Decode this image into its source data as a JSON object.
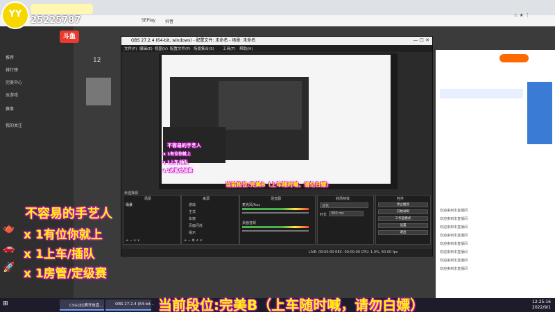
{
  "streamer": {
    "uid": "25225787",
    "avatar_label": "YY"
  },
  "browser": {
    "bookmarks": [
      "SEPlay",
      "抖音"
    ]
  },
  "site": {
    "logo": "斗鱼",
    "sidebar_items": [
      "推荐",
      "排行榜",
      "完美中心",
      "云游戏",
      "赛事",
      "我的关注"
    ],
    "count": "12"
  },
  "obs": {
    "title": "OBS 27.2.4 (64-bit, windows) - 配置文件: 未命名 - 场景: 未命名",
    "menu": [
      "文件(F)",
      "编辑(E)",
      "视图(V)",
      "配置文件(P)",
      "场景集合(S)",
      "工具(T)",
      "帮助(H)"
    ],
    "docks": [
      "场景",
      "来源",
      "混音器",
      "转场特效",
      "控件"
    ],
    "scene_item": "场景",
    "sources": [
      "游戏",
      "主式",
      "车窗",
      "页面闪烁",
      "提示"
    ],
    "mixer": [
      "麦克风/Aux",
      "桌面音频"
    ],
    "transition": "淡化",
    "duration_label": "时长",
    "duration_value": "300 ms",
    "controls": [
      "停止推流",
      "开始录制",
      "工作室模式",
      "设置",
      "退出"
    ],
    "status": "LIVE: 00:00:00   REC: 00:00:00   CPU: 1.0%, 60.00 fps",
    "no_source_label": "未选择源"
  },
  "overlay": {
    "title": "不容易的手艺人",
    "lines": [
      "x 1有位你就上",
      "x 1上车/插队",
      "x 1房管/定级赛"
    ],
    "rank_banner": "当前段位:完美B（上车随时喊，请勿白嫖）"
  },
  "chat": {
    "lines": [
      "欢迎来到本直播间",
      "欢迎来到本直播间",
      "欢迎来到本直播间",
      "欢迎来到本直播间",
      "欢迎来到本直播间",
      "欢迎来到本直播间",
      "欢迎来到本直播间",
      "欢迎来到本直播间"
    ]
  },
  "taskbar": {
    "apps": [
      "CSGO比赛开放直...",
      "OBS 27.2.4 (64-bit..."
    ],
    "time": "12:25:16",
    "date": "2022/9/1"
  },
  "colors": {
    "overlay_yellow": "#fff700",
    "overlay_magenta": "#c000c0",
    "logo_red": "#e83a2d",
    "avatar_yellow": "#f6d800"
  }
}
